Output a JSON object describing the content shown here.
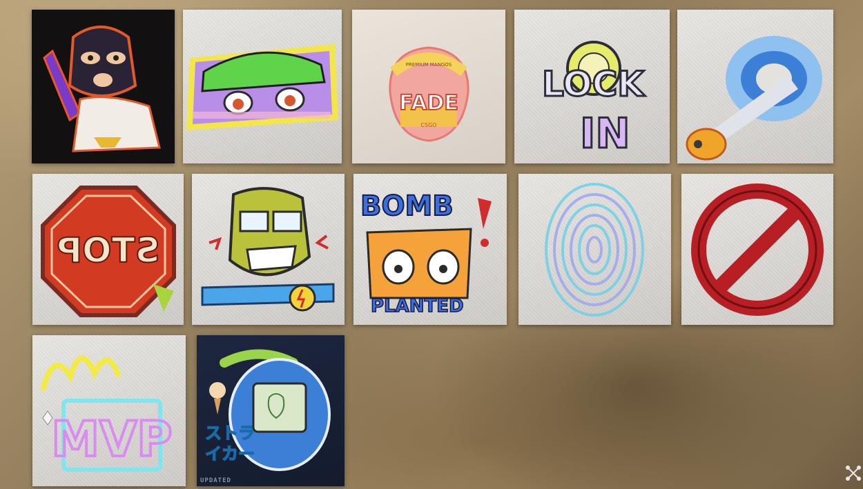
{
  "stickers": [
    {
      "id": "terrorist",
      "name": "Masked Terrorist"
    },
    {
      "id": "anime-eyes",
      "name": "Anime Eyes"
    },
    {
      "id": "fade",
      "name": "Fade",
      "label": "FADE",
      "small_text": "PREMIUM MANGOS",
      "sub_text": "CSGO"
    },
    {
      "id": "lock-in",
      "name": "Lock In",
      "label_top": "LOCK",
      "label_bottom": "IN"
    },
    {
      "id": "bullet-smoke",
      "name": "Bullet Through Smoke"
    },
    {
      "id": "stop-sign",
      "name": "Stop Sign",
      "label": "STOP"
    },
    {
      "id": "angry-face",
      "name": "Angry Face"
    },
    {
      "id": "bomb-planted",
      "name": "Bomb Planted",
      "label_top": "BOMB",
      "label_bottom": "PLANTED"
    },
    {
      "id": "fingerprint",
      "name": "Fingerprint"
    },
    {
      "id": "no-sign",
      "name": "No Sign"
    },
    {
      "id": "mvp",
      "name": "MVP",
      "label": "MVP"
    },
    {
      "id": "tamagotchi",
      "name": "Striker Tamagotchi",
      "jp_line1": "ストラ",
      "jp_line2": "イカー",
      "corner": "UPDATED"
    }
  ],
  "colors": {
    "background": "#9c8764",
    "tile_light": "#e4e2df",
    "accent_red": "#d22b2b",
    "accent_blue": "#3c7fd6"
  }
}
